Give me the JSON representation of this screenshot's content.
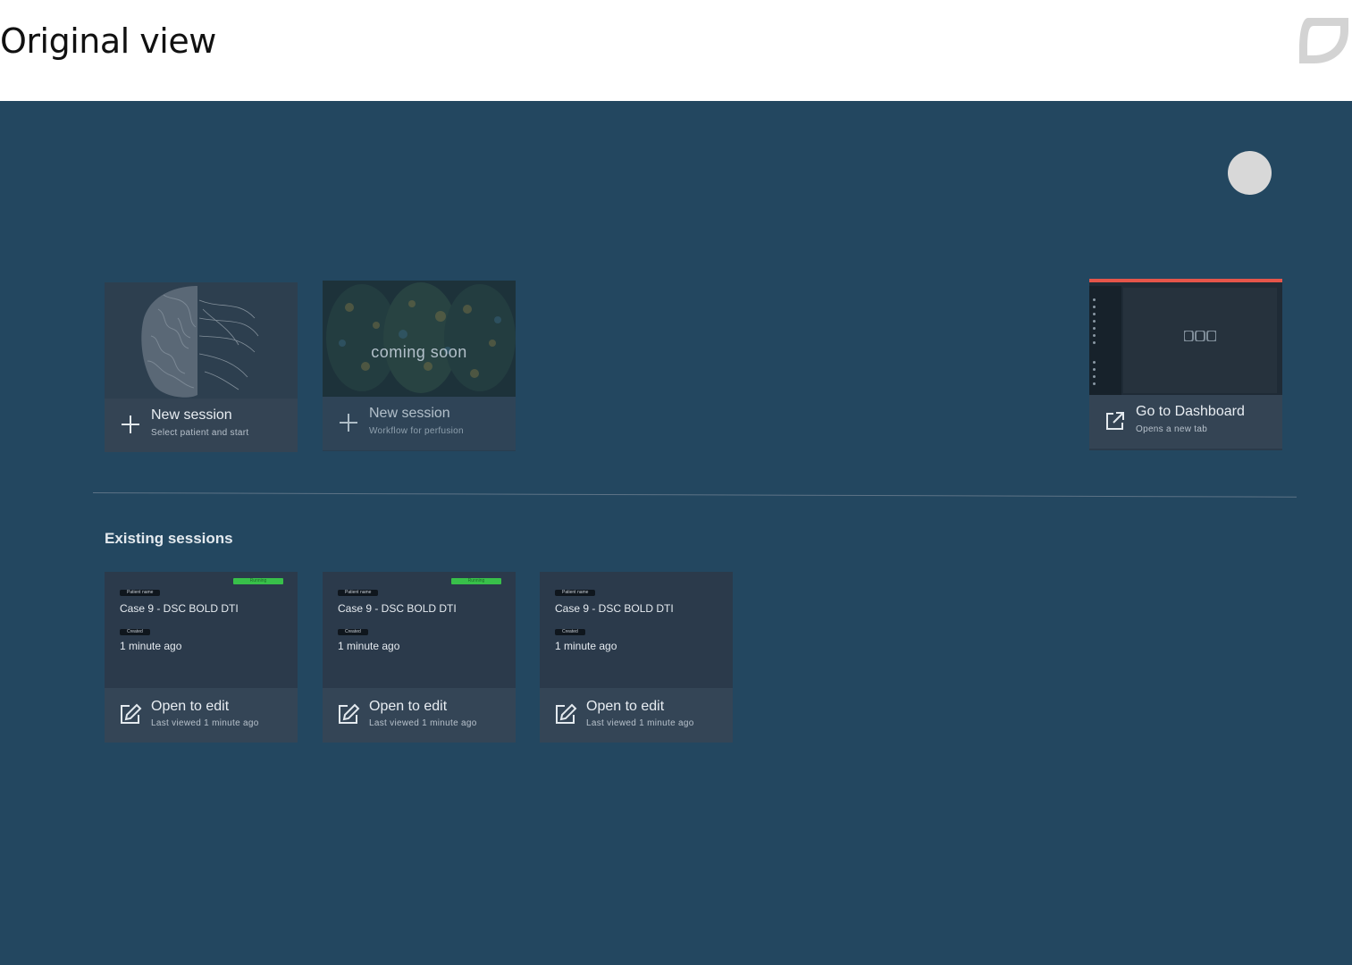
{
  "page": {
    "heading": "Original view"
  },
  "launch": {
    "new_session": {
      "title": "New session",
      "subtitle": "Select patient and start"
    },
    "perfusion": {
      "overlay": "coming soon",
      "title": "New session",
      "subtitle": "Workflow for perfusion"
    },
    "dashboard": {
      "title": "Go to Dashboard",
      "subtitle": "Opens a new tab"
    }
  },
  "sessions": {
    "title": "Existing sessions",
    "items": [
      {
        "status": "Running",
        "patient_label": "Patient name",
        "case": "Case 9 - DSC BOLD DTI",
        "created_label": "Created",
        "created": "1 minute ago",
        "action": "Open to edit",
        "last_viewed": "Last viewed 1 minute ago"
      },
      {
        "status": "Running",
        "patient_label": "Patient name",
        "case": "Case 9 - DSC BOLD DTI",
        "created_label": "Created",
        "created": "1 minute ago",
        "action": "Open to edit",
        "last_viewed": "Last viewed 1 minute ago"
      },
      {
        "status": "",
        "patient_label": "Patient name",
        "case": "Case 9 - DSC BOLD DTI",
        "created_label": "Created",
        "created": "1 minute ago",
        "action": "Open to edit",
        "last_viewed": "Last viewed 1 minute ago"
      }
    ]
  },
  "colors": {
    "background": "#234760",
    "card": "#2b3a4a",
    "running": "#38c04a",
    "accent_bar": "#e5554a"
  },
  "icons": [
    "brand-logo",
    "avatar",
    "plus-icon",
    "external-link-icon",
    "edit-icon"
  ]
}
